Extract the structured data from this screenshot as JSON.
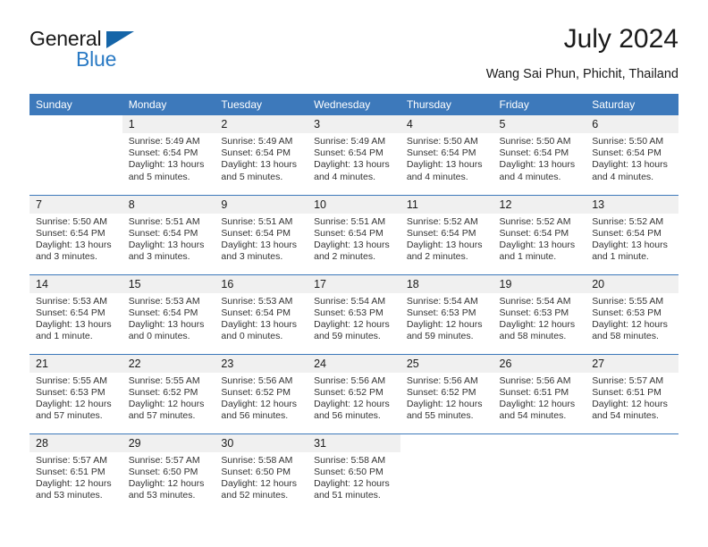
{
  "logo": {
    "text_primary": "General",
    "text_secondary": "Blue",
    "icon": "triangle-mark",
    "color_primary": "#1a1a1a",
    "color_secondary": "#2a7ac4",
    "color_triangle": "#1565a8"
  },
  "header": {
    "title": "July 2024",
    "subtitle": "Wang Sai Phun, Phichit, Thailand"
  },
  "theme": {
    "header_blue": "#3d79bb",
    "daynum_band": "#f0f0f0",
    "text": "#333333"
  },
  "calendar": {
    "weekday_headers": [
      "Sunday",
      "Monday",
      "Tuesday",
      "Wednesday",
      "Thursday",
      "Friday",
      "Saturday"
    ],
    "weeks": [
      [
        {
          "day": "",
          "empty": true,
          "sunrise": "",
          "sunset": "",
          "daylight_1": "",
          "daylight_2": ""
        },
        {
          "day": "1",
          "sunrise": "Sunrise: 5:49 AM",
          "sunset": "Sunset: 6:54 PM",
          "daylight_1": "Daylight: 13 hours",
          "daylight_2": "and 5 minutes."
        },
        {
          "day": "2",
          "sunrise": "Sunrise: 5:49 AM",
          "sunset": "Sunset: 6:54 PM",
          "daylight_1": "Daylight: 13 hours",
          "daylight_2": "and 5 minutes."
        },
        {
          "day": "3",
          "sunrise": "Sunrise: 5:49 AM",
          "sunset": "Sunset: 6:54 PM",
          "daylight_1": "Daylight: 13 hours",
          "daylight_2": "and 4 minutes."
        },
        {
          "day": "4",
          "sunrise": "Sunrise: 5:50 AM",
          "sunset": "Sunset: 6:54 PM",
          "daylight_1": "Daylight: 13 hours",
          "daylight_2": "and 4 minutes."
        },
        {
          "day": "5",
          "sunrise": "Sunrise: 5:50 AM",
          "sunset": "Sunset: 6:54 PM",
          "daylight_1": "Daylight: 13 hours",
          "daylight_2": "and 4 minutes."
        },
        {
          "day": "6",
          "sunrise": "Sunrise: 5:50 AM",
          "sunset": "Sunset: 6:54 PM",
          "daylight_1": "Daylight: 13 hours",
          "daylight_2": "and 4 minutes."
        }
      ],
      [
        {
          "day": "7",
          "sunrise": "Sunrise: 5:50 AM",
          "sunset": "Sunset: 6:54 PM",
          "daylight_1": "Daylight: 13 hours",
          "daylight_2": "and 3 minutes."
        },
        {
          "day": "8",
          "sunrise": "Sunrise: 5:51 AM",
          "sunset": "Sunset: 6:54 PM",
          "daylight_1": "Daylight: 13 hours",
          "daylight_2": "and 3 minutes."
        },
        {
          "day": "9",
          "sunrise": "Sunrise: 5:51 AM",
          "sunset": "Sunset: 6:54 PM",
          "daylight_1": "Daylight: 13 hours",
          "daylight_2": "and 3 minutes."
        },
        {
          "day": "10",
          "sunrise": "Sunrise: 5:51 AM",
          "sunset": "Sunset: 6:54 PM",
          "daylight_1": "Daylight: 13 hours",
          "daylight_2": "and 2 minutes."
        },
        {
          "day": "11",
          "sunrise": "Sunrise: 5:52 AM",
          "sunset": "Sunset: 6:54 PM",
          "daylight_1": "Daylight: 13 hours",
          "daylight_2": "and 2 minutes."
        },
        {
          "day": "12",
          "sunrise": "Sunrise: 5:52 AM",
          "sunset": "Sunset: 6:54 PM",
          "daylight_1": "Daylight: 13 hours",
          "daylight_2": "and 1 minute."
        },
        {
          "day": "13",
          "sunrise": "Sunrise: 5:52 AM",
          "sunset": "Sunset: 6:54 PM",
          "daylight_1": "Daylight: 13 hours",
          "daylight_2": "and 1 minute."
        }
      ],
      [
        {
          "day": "14",
          "sunrise": "Sunrise: 5:53 AM",
          "sunset": "Sunset: 6:54 PM",
          "daylight_1": "Daylight: 13 hours",
          "daylight_2": "and 1 minute."
        },
        {
          "day": "15",
          "sunrise": "Sunrise: 5:53 AM",
          "sunset": "Sunset: 6:54 PM",
          "daylight_1": "Daylight: 13 hours",
          "daylight_2": "and 0 minutes."
        },
        {
          "day": "16",
          "sunrise": "Sunrise: 5:53 AM",
          "sunset": "Sunset: 6:54 PM",
          "daylight_1": "Daylight: 13 hours",
          "daylight_2": "and 0 minutes."
        },
        {
          "day": "17",
          "sunrise": "Sunrise: 5:54 AM",
          "sunset": "Sunset: 6:53 PM",
          "daylight_1": "Daylight: 12 hours",
          "daylight_2": "and 59 minutes."
        },
        {
          "day": "18",
          "sunrise": "Sunrise: 5:54 AM",
          "sunset": "Sunset: 6:53 PM",
          "daylight_1": "Daylight: 12 hours",
          "daylight_2": "and 59 minutes."
        },
        {
          "day": "19",
          "sunrise": "Sunrise: 5:54 AM",
          "sunset": "Sunset: 6:53 PM",
          "daylight_1": "Daylight: 12 hours",
          "daylight_2": "and 58 minutes."
        },
        {
          "day": "20",
          "sunrise": "Sunrise: 5:55 AM",
          "sunset": "Sunset: 6:53 PM",
          "daylight_1": "Daylight: 12 hours",
          "daylight_2": "and 58 minutes."
        }
      ],
      [
        {
          "day": "21",
          "sunrise": "Sunrise: 5:55 AM",
          "sunset": "Sunset: 6:53 PM",
          "daylight_1": "Daylight: 12 hours",
          "daylight_2": "and 57 minutes."
        },
        {
          "day": "22",
          "sunrise": "Sunrise: 5:55 AM",
          "sunset": "Sunset: 6:52 PM",
          "daylight_1": "Daylight: 12 hours",
          "daylight_2": "and 57 minutes."
        },
        {
          "day": "23",
          "sunrise": "Sunrise: 5:56 AM",
          "sunset": "Sunset: 6:52 PM",
          "daylight_1": "Daylight: 12 hours",
          "daylight_2": "and 56 minutes."
        },
        {
          "day": "24",
          "sunrise": "Sunrise: 5:56 AM",
          "sunset": "Sunset: 6:52 PM",
          "daylight_1": "Daylight: 12 hours",
          "daylight_2": "and 56 minutes."
        },
        {
          "day": "25",
          "sunrise": "Sunrise: 5:56 AM",
          "sunset": "Sunset: 6:52 PM",
          "daylight_1": "Daylight: 12 hours",
          "daylight_2": "and 55 minutes."
        },
        {
          "day": "26",
          "sunrise": "Sunrise: 5:56 AM",
          "sunset": "Sunset: 6:51 PM",
          "daylight_1": "Daylight: 12 hours",
          "daylight_2": "and 54 minutes."
        },
        {
          "day": "27",
          "sunrise": "Sunrise: 5:57 AM",
          "sunset": "Sunset: 6:51 PM",
          "daylight_1": "Daylight: 12 hours",
          "daylight_2": "and 54 minutes."
        }
      ],
      [
        {
          "day": "28",
          "sunrise": "Sunrise: 5:57 AM",
          "sunset": "Sunset: 6:51 PM",
          "daylight_1": "Daylight: 12 hours",
          "daylight_2": "and 53 minutes."
        },
        {
          "day": "29",
          "sunrise": "Sunrise: 5:57 AM",
          "sunset": "Sunset: 6:50 PM",
          "daylight_1": "Daylight: 12 hours",
          "daylight_2": "and 53 minutes."
        },
        {
          "day": "30",
          "sunrise": "Sunrise: 5:58 AM",
          "sunset": "Sunset: 6:50 PM",
          "daylight_1": "Daylight: 12 hours",
          "daylight_2": "and 52 minutes."
        },
        {
          "day": "31",
          "sunrise": "Sunrise: 5:58 AM",
          "sunset": "Sunset: 6:50 PM",
          "daylight_1": "Daylight: 12 hours",
          "daylight_2": "and 51 minutes."
        },
        {
          "day": "",
          "empty": true,
          "sunrise": "",
          "sunset": "",
          "daylight_1": "",
          "daylight_2": ""
        },
        {
          "day": "",
          "empty": true,
          "sunrise": "",
          "sunset": "",
          "daylight_1": "",
          "daylight_2": ""
        },
        {
          "day": "",
          "empty": true,
          "sunrise": "",
          "sunset": "",
          "daylight_1": "",
          "daylight_2": ""
        }
      ]
    ]
  }
}
